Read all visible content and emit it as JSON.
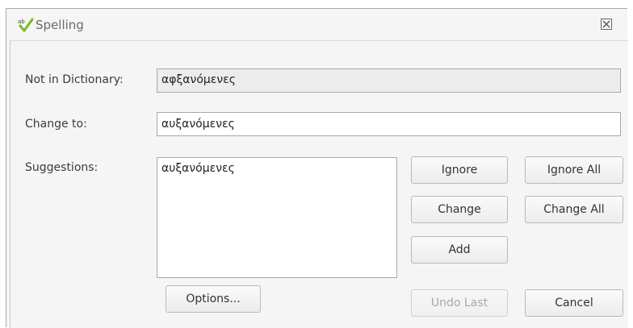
{
  "window": {
    "title": "Spelling",
    "icon": "spellcheck-icon",
    "close_glyph": "☒"
  },
  "fields": {
    "not_in_dictionary_label": "Not in Dictionary:",
    "not_in_dictionary_value": "αφξανόμενες",
    "change_to_label": "Change to:",
    "change_to_value": "αυξανόμενες",
    "suggestions_label": "Suggestions:"
  },
  "suggestions": [
    "αυξανόμενες"
  ],
  "buttons": {
    "ignore": "Ignore",
    "ignore_all": "Ignore All",
    "change": "Change",
    "change_all": "Change All",
    "add": "Add",
    "options": "Options...",
    "undo_last": "Undo Last",
    "cancel": "Cancel"
  },
  "colors": {
    "check_green": "#7bbf2a",
    "dialog_bg": "#f5f5f5",
    "disabled_text": "#a8a8a8"
  }
}
